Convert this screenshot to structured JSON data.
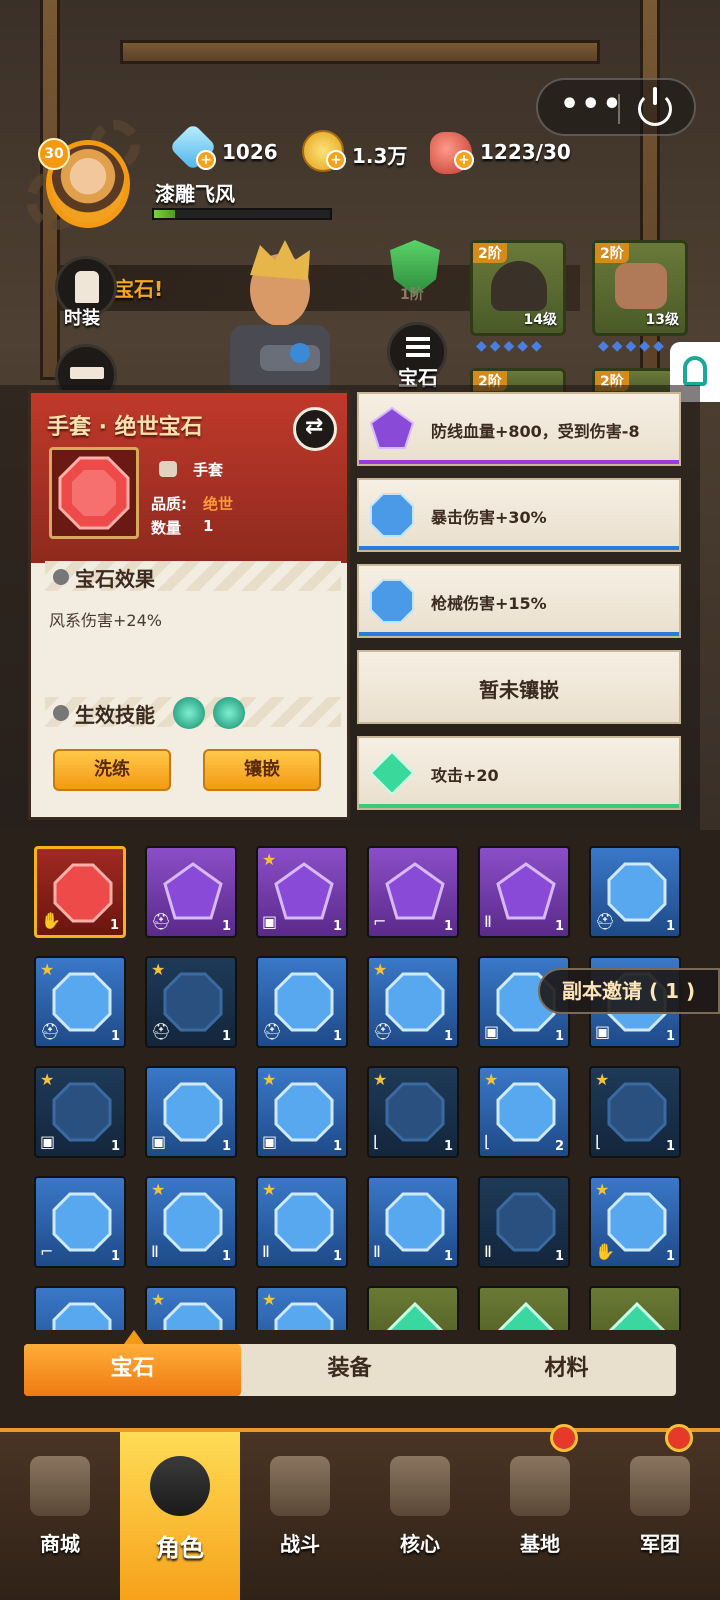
{
  "header": {
    "level": "30",
    "player_name": "漆雕飞风",
    "exp_progress": 0.12,
    "resources": [
      {
        "name": "diamond",
        "icon": "diamond-icon",
        "value": "1026"
      },
      {
        "name": "coin",
        "icon": "coin-icon",
        "value": "1.3万"
      },
      {
        "name": "meat",
        "icon": "meat-icon",
        "value": "1223/30"
      }
    ]
  },
  "left_menu": {
    "costume_label": "时装",
    "banner_text": "宝石!"
  },
  "center": {
    "shield_label": "1阶",
    "gem_button_label": "宝石"
  },
  "equipment": [
    {
      "tier": "2阶",
      "level": "14级",
      "gems": "◆◆◆◆◆"
    },
    {
      "tier": "2阶",
      "level": "13级",
      "gems": "◆◆◆◆◆"
    },
    {
      "tier": "2阶",
      "level": ""
    },
    {
      "tier": "2阶",
      "level": ""
    }
  ],
  "gem_card": {
    "title": "手套 · 绝世宝石",
    "part_label": "手套",
    "quality_label": "品质:",
    "quality_value": "绝世",
    "count_label": "数量",
    "count_value": "1",
    "effect_title": "宝石效果",
    "effect_text": "风系伤害+24%",
    "skill_title": "生效技能",
    "refine_button": "洗练",
    "inlay_button": "镶嵌"
  },
  "slots": [
    {
      "color": "purple",
      "text": "防线血量+800，受到伤害-8"
    },
    {
      "color": "blue",
      "text": "暴击伤害+30%"
    },
    {
      "color": "blue",
      "text": "枪械伤害+15%"
    },
    {
      "color": "empty",
      "text": "暂未镶嵌"
    },
    {
      "color": "green",
      "text": "攻击+20"
    }
  ],
  "invite_label": "副本邀请 ( 1 )",
  "grid": [
    {
      "color": "red",
      "star": false,
      "count": "1",
      "part": "glove"
    },
    {
      "color": "purple",
      "star": false,
      "count": "1",
      "part": "helmet"
    },
    {
      "color": "purple",
      "star": true,
      "count": "1",
      "part": "armor"
    },
    {
      "color": "purple",
      "star": false,
      "count": "1",
      "part": "gun"
    },
    {
      "color": "purple",
      "star": false,
      "count": "1",
      "part": "pants"
    },
    {
      "color": "blue",
      "star": false,
      "count": "1",
      "part": "helmet"
    },
    {
      "color": "blue",
      "star": true,
      "count": "1",
      "part": "helmet"
    },
    {
      "color": "dark",
      "star": true,
      "count": "1",
      "part": "helmet"
    },
    {
      "color": "blue",
      "star": false,
      "count": "1",
      "part": "helmet"
    },
    {
      "color": "blue",
      "star": true,
      "count": "1",
      "part": "helmet"
    },
    {
      "color": "blue",
      "star": false,
      "count": "1",
      "part": "armor"
    },
    {
      "color": "blue",
      "star": false,
      "count": "1",
      "part": "armor"
    },
    {
      "color": "dark",
      "star": true,
      "count": "1",
      "part": "armor"
    },
    {
      "color": "blue",
      "star": false,
      "count": "1",
      "part": "armor"
    },
    {
      "color": "blue",
      "star": true,
      "count": "1",
      "part": "armor"
    },
    {
      "color": "dark",
      "star": true,
      "count": "1",
      "part": "boot"
    },
    {
      "color": "blue",
      "star": true,
      "count": "2",
      "part": "boot"
    },
    {
      "color": "dark",
      "star": true,
      "count": "1",
      "part": "boot"
    },
    {
      "color": "blue",
      "star": false,
      "count": "1",
      "part": "gun"
    },
    {
      "color": "blue",
      "star": true,
      "count": "1",
      "part": "pants"
    },
    {
      "color": "blue",
      "star": true,
      "count": "1",
      "part": "pants"
    },
    {
      "color": "blue",
      "star": false,
      "count": "1",
      "part": "pants"
    },
    {
      "color": "dark",
      "star": false,
      "count": "1",
      "part": "pants"
    },
    {
      "color": "blue",
      "star": true,
      "count": "1",
      "part": "glove"
    },
    {
      "color": "blue",
      "star": false,
      "count": "",
      "part": ""
    },
    {
      "color": "blue",
      "star": true,
      "count": "",
      "part": ""
    },
    {
      "color": "blue",
      "star": true,
      "count": "",
      "part": ""
    },
    {
      "color": "green",
      "star": false,
      "count": "",
      "part": ""
    },
    {
      "color": "green",
      "star": false,
      "count": "",
      "part": ""
    },
    {
      "color": "green",
      "star": false,
      "count": "",
      "part": ""
    }
  ],
  "tabs": [
    "宝石",
    "装备",
    "材料"
  ],
  "active_tab": 0,
  "nav": [
    {
      "label": "商城",
      "icon": "shop-icon",
      "notif": false
    },
    {
      "label": "角色",
      "icon": "character-icon",
      "notif": false
    },
    {
      "label": "战斗",
      "icon": "battle-icon",
      "notif": false
    },
    {
      "label": "核心",
      "icon": "core-icon",
      "notif": false
    },
    {
      "label": "基地",
      "icon": "base-icon",
      "notif": true
    },
    {
      "label": "军团",
      "icon": "legion-icon",
      "notif": true
    }
  ],
  "active_nav": 1
}
